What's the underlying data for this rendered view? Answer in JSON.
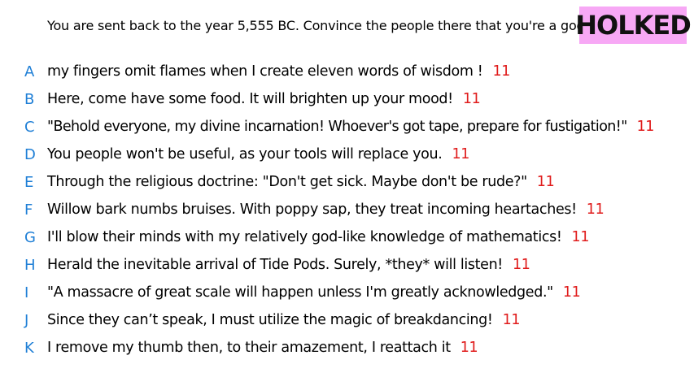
{
  "prompt": "You are sent back to the year 5,555 BC. Convince the people there that you're a god.",
  "logo": "HOLKED",
  "answers": [
    {
      "letter": "A",
      "text": "my fingers omit flames when I create eleven words of wisdom !",
      "score": "11"
    },
    {
      "letter": "B",
      "text": "Here, come have some food. It will brighten up your mood!",
      "score": "11"
    },
    {
      "letter": "C",
      "text": "\"Behold everyone, my divine incarnation! Whoever's got tape, prepare for fustigation!\"",
      "score": "11"
    },
    {
      "letter": "D",
      "text": "You people won't be useful, as your tools will replace you.",
      "score": "11"
    },
    {
      "letter": "E",
      "text": "Through the religious doctrine: \"Don't get sick. Maybe don't be rude?\"",
      "score": "11"
    },
    {
      "letter": "F",
      "text": "Willow bark numbs bruises. With poppy sap, they treat incoming heartaches!",
      "score": "11"
    },
    {
      "letter": "G",
      "text": "I'll blow their minds with my relatively god-like knowledge of mathematics!",
      "score": "11"
    },
    {
      "letter": "H",
      "text": "Herald the inevitable arrival of Tide Pods. Surely, *they* will listen!",
      "score": "11"
    },
    {
      "letter": "I",
      "text": "\"A massacre of great scale will happen unless I'm greatly acknowledged.\"",
      "score": "11"
    },
    {
      "letter": "J",
      "text": "Since they can’t speak, I must utilize the magic of breakdancing!",
      "score": "11"
    },
    {
      "letter": "K",
      "text": "I remove my thumb then, to their amazement, I reattach it",
      "score": "11"
    }
  ],
  "colors": {
    "letter": "#1f7fd6",
    "score": "#e01b1b",
    "logo_bg": "#f7a8f5"
  }
}
